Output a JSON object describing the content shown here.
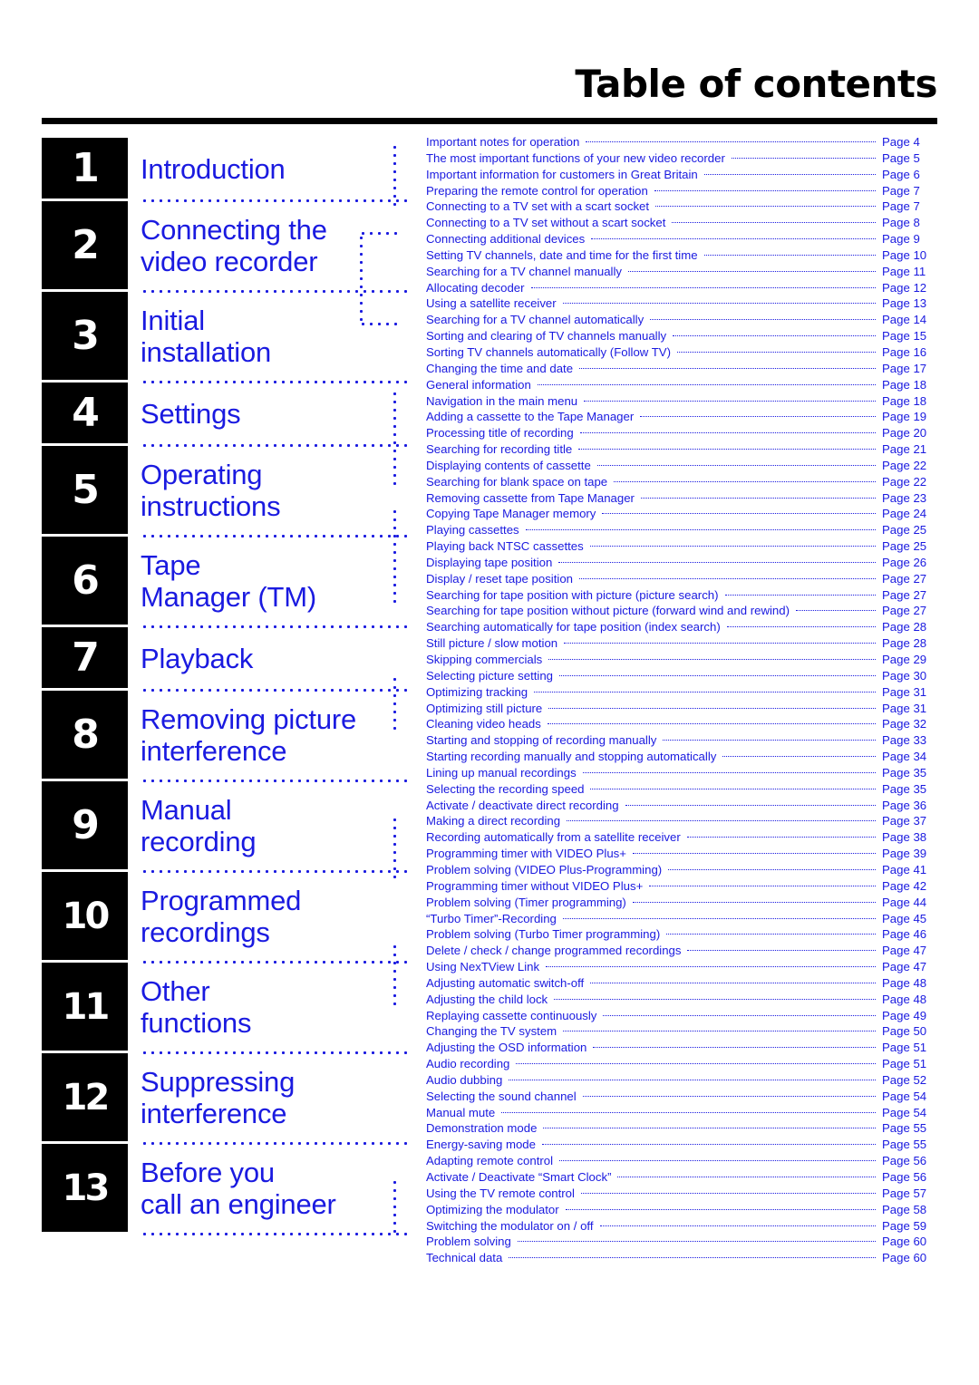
{
  "header": {
    "title": "Table of contents"
  },
  "chapters": [
    {
      "num": "1",
      "lines": [
        "Introduction"
      ]
    },
    {
      "num": "2",
      "lines": [
        "Connecting the",
        "video recorder"
      ]
    },
    {
      "num": "3",
      "lines": [
        "Initial",
        "installation"
      ]
    },
    {
      "num": "4",
      "lines": [
        "Settings"
      ]
    },
    {
      "num": "5",
      "lines": [
        "Operating",
        "instructions"
      ]
    },
    {
      "num": "6",
      "lines": [
        "Tape",
        "Manager (TM)"
      ]
    },
    {
      "num": "7",
      "lines": [
        "Playback"
      ]
    },
    {
      "num": "8",
      "lines": [
        "Removing picture",
        "interference"
      ]
    },
    {
      "num": "9",
      "lines": [
        "Manual",
        "recording"
      ]
    },
    {
      "num": "10",
      "lines": [
        "Programmed",
        "recordings"
      ]
    },
    {
      "num": "11",
      "lines": [
        "Other",
        "functions"
      ]
    },
    {
      "num": "12",
      "lines": [
        "Suppressing",
        "interference"
      ]
    },
    {
      "num": "13",
      "lines": [
        "Before you",
        "call an engineer"
      ]
    }
  ],
  "entries": [
    {
      "text": "Important notes for operation",
      "page": "Page 4"
    },
    {
      "text": "The most important functions of your new video recorder",
      "page": "Page 5"
    },
    {
      "text": "Important information for customers in Great Britain",
      "page": "Page 6"
    },
    {
      "text": "Preparing the remote control for operation",
      "page": "Page 7"
    },
    {
      "text": "Connecting to a TV set with a scart socket",
      "page": "Page 7"
    },
    {
      "text": "Connecting to a TV set without a scart socket",
      "page": "Page 8"
    },
    {
      "text": "Connecting additional devices",
      "page": "Page 9"
    },
    {
      "text": "Setting TV channels, date and time for the  first time",
      "page": "Page 10"
    },
    {
      "text": "Searching for a TV channel manually",
      "page": "Page 11"
    },
    {
      "text": "Allocating decoder",
      "page": "Page 12"
    },
    {
      "text": "Using a satellite receiver",
      "page": "Page 13"
    },
    {
      "text": "Searching for a TV channel automatically",
      "page": "Page 14"
    },
    {
      "text": "Sorting and clearing of TV channels manually",
      "page": "Page 15"
    },
    {
      "text": "Sorting TV channels automatically (Follow TV)",
      "page": "Page 16"
    },
    {
      "text": "Changing the time and  date",
      "page": "Page 17"
    },
    {
      "text": "General information",
      "page": "Page 18"
    },
    {
      "text": "Navigation in the main menu",
      "page": "Page 18"
    },
    {
      "text": "Adding a cassette to the Tape Manager",
      "page": "Page 19"
    },
    {
      "text": "Processing title of recording",
      "page": "Page 20"
    },
    {
      "text": "Searching for recording title",
      "page": "Page 21"
    },
    {
      "text": "Displaying contents of cassette",
      "page": "Page 22"
    },
    {
      "text": "Searching for blank space on tape",
      "page": "Page 22"
    },
    {
      "text": "Removing cassette from Tape Manager",
      "page": "Page 23"
    },
    {
      "text": "Copying Tape Manager memory",
      "page": "Page 24"
    },
    {
      "text": "Playing cassettes",
      "page": "Page 25"
    },
    {
      "text": "Playing back NTSC cassettes",
      "page": "Page 25"
    },
    {
      "text": "Displaying tape position",
      "page": "Page 26"
    },
    {
      "text": "Display / reset tape position",
      "page": "Page 27"
    },
    {
      "text": "Searching for tape position with picture (picture search)",
      "page": "Page 27"
    },
    {
      "text": "Searching for tape position without picture (forward wind and rewind)",
      "page": "Page 27"
    },
    {
      "text": "Searching automatically for tape position (index search)",
      "page": "Page 28"
    },
    {
      "text": "Still picture /  slow motion",
      "page": "Page 28"
    },
    {
      "text": "Skipping commercials",
      "page": "Page 29"
    },
    {
      "text": "Selecting picture setting",
      "page": "Page 30"
    },
    {
      "text": "Optimizing tracking",
      "page": "Page 31"
    },
    {
      "text": "Optimizing still picture",
      "page": "Page 31"
    },
    {
      "text": "Cleaning video heads",
      "page": "Page 32"
    },
    {
      "text": "Starting and stopping of recording manually",
      "page": "Page 33"
    },
    {
      "text": "Starting recording manually and stopping automatically",
      "page": "Page 34"
    },
    {
      "text": "Lining up manual recordings",
      "page": "Page 35"
    },
    {
      "text": "Selecting the recording speed",
      "page": "Page 35"
    },
    {
      "text": "Activate / deactivate direct recording",
      "page": "Page 36"
    },
    {
      "text": "Making a direct recording",
      "page": "Page 37"
    },
    {
      "text": "Recording automatically from a satellite receiver",
      "page": "Page 38"
    },
    {
      "text": "Programming timer with VIDEO Plus+",
      "page": "Page 39"
    },
    {
      "text": "Problem solving (VIDEO Plus-Programming)",
      "page": "Page 41"
    },
    {
      "text": "Programming timer without VIDEO Plus+",
      "page": "Page 42"
    },
    {
      "text": "Problem solving (Timer programming)",
      "page": "Page 44"
    },
    {
      "text": "“Turbo Timer”-Recording",
      "page": "Page 45"
    },
    {
      "text": "Problem solving (Turbo Timer programming)",
      "page": "Page 46"
    },
    {
      "text": "Delete / check / change programmed recordings",
      "page": "Page 47"
    },
    {
      "text": "Using NexTView Link",
      "page": "Page 47"
    },
    {
      "text": "Adjusting automatic switch-off",
      "page": "Page 48"
    },
    {
      "text": "Adjusting the child lock",
      "page": "Page 48"
    },
    {
      "text": "Replaying cassette continuously",
      "page": "Page 49"
    },
    {
      "text": "Changing the TV system",
      "page": "Page 50"
    },
    {
      "text": "Adjusting the OSD information",
      "page": "Page 51"
    },
    {
      "text": "Audio recording",
      "page": "Page 51"
    },
    {
      "text": "Audio dubbing",
      "page": "Page 52"
    },
    {
      "text": "Selecting the sound channel",
      "page": "Page 54"
    },
    {
      "text": "Manual mute",
      "page": "Page 54"
    },
    {
      "text": "Demonstration mode",
      "page": "Page 55"
    },
    {
      "text": "Energy-saving mode",
      "page": "Page 55"
    },
    {
      "text": "Adapting remote control",
      "page": "Page 56"
    },
    {
      "text": "Activate / Deactivate “Smart Clock”",
      "page": "Page 56"
    },
    {
      "text": "Using the TV remote control",
      "page": "Page 57"
    },
    {
      "text": "Optimizing the modulator",
      "page": "Page 58"
    },
    {
      "text": "Switching the modulator on / off",
      "page": "Page 59"
    },
    {
      "text": "Problem solving",
      "page": "Page 60"
    },
    {
      "text": "Technical data",
      "page": "Page 60"
    }
  ]
}
